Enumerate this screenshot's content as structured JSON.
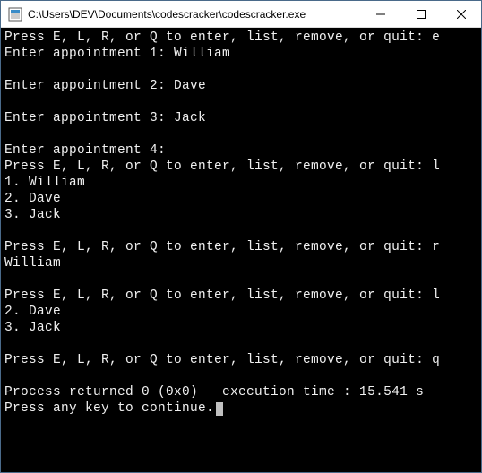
{
  "window": {
    "title": "C:\\Users\\DEV\\Documents\\codescracker\\codescracker.exe"
  },
  "console": {
    "lines": [
      "Press E, L, R, or Q to enter, list, remove, or quit: e",
      "Enter appointment 1: William",
      "",
      "Enter appointment 2: Dave",
      "",
      "Enter appointment 3: Jack",
      "",
      "Enter appointment 4:",
      "Press E, L, R, or Q to enter, list, remove, or quit: l",
      "1. William",
      "2. Dave",
      "3. Jack",
      "",
      "Press E, L, R, or Q to enter, list, remove, or quit: r",
      "William",
      "",
      "Press E, L, R, or Q to enter, list, remove, or quit: l",
      "2. Dave",
      "3. Jack",
      "",
      "Press E, L, R, or Q to enter, list, remove, or quit: q",
      "",
      "Process returned 0 (0x0)   execution time : 15.541 s",
      "Press any key to continue."
    ]
  }
}
